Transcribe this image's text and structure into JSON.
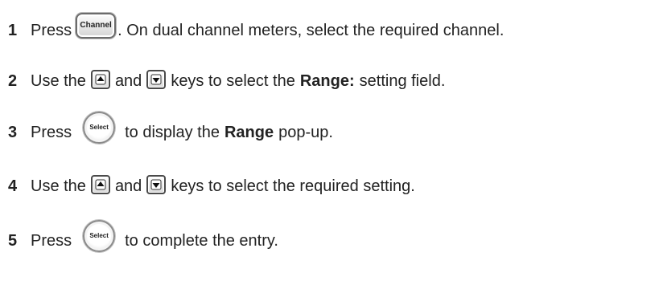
{
  "steps": [
    {
      "number": "1",
      "parts": {
        "press": "Press",
        "key_label": "Channel",
        "rest": ". On dual channel meters, select the required channel."
      }
    },
    {
      "number": "2",
      "parts": {
        "use_the": "Use the",
        "and": "and",
        "keys_to_select": "keys to select the",
        "field_name": "Range:",
        "rest": "setting field."
      }
    },
    {
      "number": "3",
      "parts": {
        "press": "Press",
        "key_label": "Select",
        "to_display": "to display the",
        "popup_name": "Range",
        "rest": "pop-up."
      }
    },
    {
      "number": "4",
      "parts": {
        "use_the": "Use the",
        "and": "and",
        "rest": "keys to select the required setting."
      }
    },
    {
      "number": "5",
      "parts": {
        "press": "Press",
        "key_label": "Select",
        "rest": "to complete the entry."
      }
    }
  ],
  "icons": {
    "up_arrow_key": "up-arrow-key-icon",
    "down_arrow_key": "down-arrow-key-icon",
    "channel_key": "channel-key-icon",
    "select_key": "select-key-icon"
  }
}
